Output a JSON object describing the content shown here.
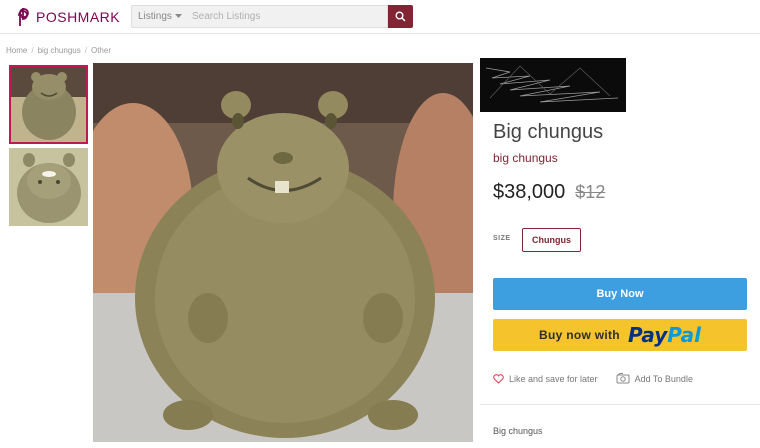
{
  "header": {
    "logo_text": "POSHMARK",
    "search_category": "Listings",
    "search_placeholder": "Search Listings"
  },
  "breadcrumb": [
    "Home",
    "big chungus",
    "Other"
  ],
  "listing": {
    "title": "Big chungus",
    "brand": "big chungus",
    "price": "$38,000",
    "original_price": "$12",
    "size_label": "SIZE",
    "size_value": "Chungus",
    "description": "Big chungus"
  },
  "buttons": {
    "buy_now": "Buy Now",
    "paypal_prefix": "Buy now with",
    "paypal_pay": "Pay",
    "paypal_pal": "Pal",
    "like_label": "Like and save for later",
    "bundle_label": "Add To Bundle"
  },
  "colors": {
    "brand": "#822433",
    "buy_now": "#3d9fe0",
    "paypal_yellow": "#f5c32c"
  },
  "icons": [
    "poshmark-logo-icon",
    "chevron-down-icon",
    "search-icon",
    "heart-icon",
    "bundle-icon"
  ]
}
